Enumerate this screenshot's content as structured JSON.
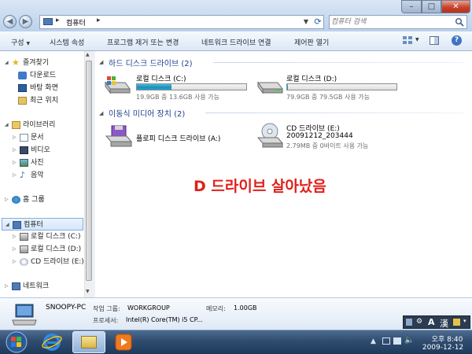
{
  "window": {
    "address": {
      "sep": "▸",
      "location": "컴퓨터"
    },
    "search_placeholder": "컴퓨터 검색",
    "controls": {
      "minimize": "–",
      "maximize": "□",
      "close": "✕"
    }
  },
  "toolbar": {
    "items": [
      "구성",
      "시스템 속성",
      "프로그램 제거 또는 변경",
      "네트워크 드라이브 연결",
      "제어판 열기"
    ]
  },
  "nav": {
    "favorites": {
      "label": "즐겨찾기",
      "items": [
        "다운로드",
        "바탕 화면",
        "최근 위치"
      ]
    },
    "libraries": {
      "label": "라이브러리",
      "items": [
        "문서",
        "비디오",
        "사진",
        "음악"
      ]
    },
    "homegroup": "홈 그룹",
    "computer": {
      "label": "컴퓨터",
      "items": [
        "로컬 디스크 (C:)",
        "로컬 디스크 (D:)",
        "CD 드라이브 (E:)"
      ]
    },
    "network": "네트워크"
  },
  "content": {
    "hard_disks": {
      "header": "하드 디스크 드라이브 (2)",
      "drives": [
        {
          "name": "로컬 디스크 (C:)",
          "space": "19.9GB 중 13.6GB 사용 가능",
          "used_fraction": 0.32
        },
        {
          "name": "로컬 디스크 (D:)",
          "space": "79.9GB 중 79.5GB 사용 가능",
          "used_fraction": 0.005
        }
      ]
    },
    "removable": {
      "header": "이동식 미디어 장치 (2)",
      "floppy": {
        "name": "플로피 디스크 드라이브 (A:)"
      },
      "cd": {
        "name": "CD 드라이브 (E:)",
        "label": "20091212_203444",
        "space": "2.79MB 중 0바이트 사용 가능"
      }
    },
    "annotation": "D 드라이브 살아났음"
  },
  "details": {
    "pc_name": "SNOOPY-PC",
    "workgroup_label": "작업 그룹:",
    "workgroup_value": "WORKGROUP",
    "memory_label": "메모리:",
    "memory_value": "1.00GB",
    "cpu_label": "프로세서:",
    "cpu_value": "Intel(R) Core(TM) i5 CP..."
  },
  "language_bar": {
    "mode": "A",
    "hanja": "漢"
  },
  "taskbar": {
    "time": "오후 8:40",
    "date": "2009-12-12"
  },
  "colors": {
    "accent": "#1e3f8f",
    "annotation": "#e0201a",
    "drive_fill": "#1e8fb8"
  }
}
